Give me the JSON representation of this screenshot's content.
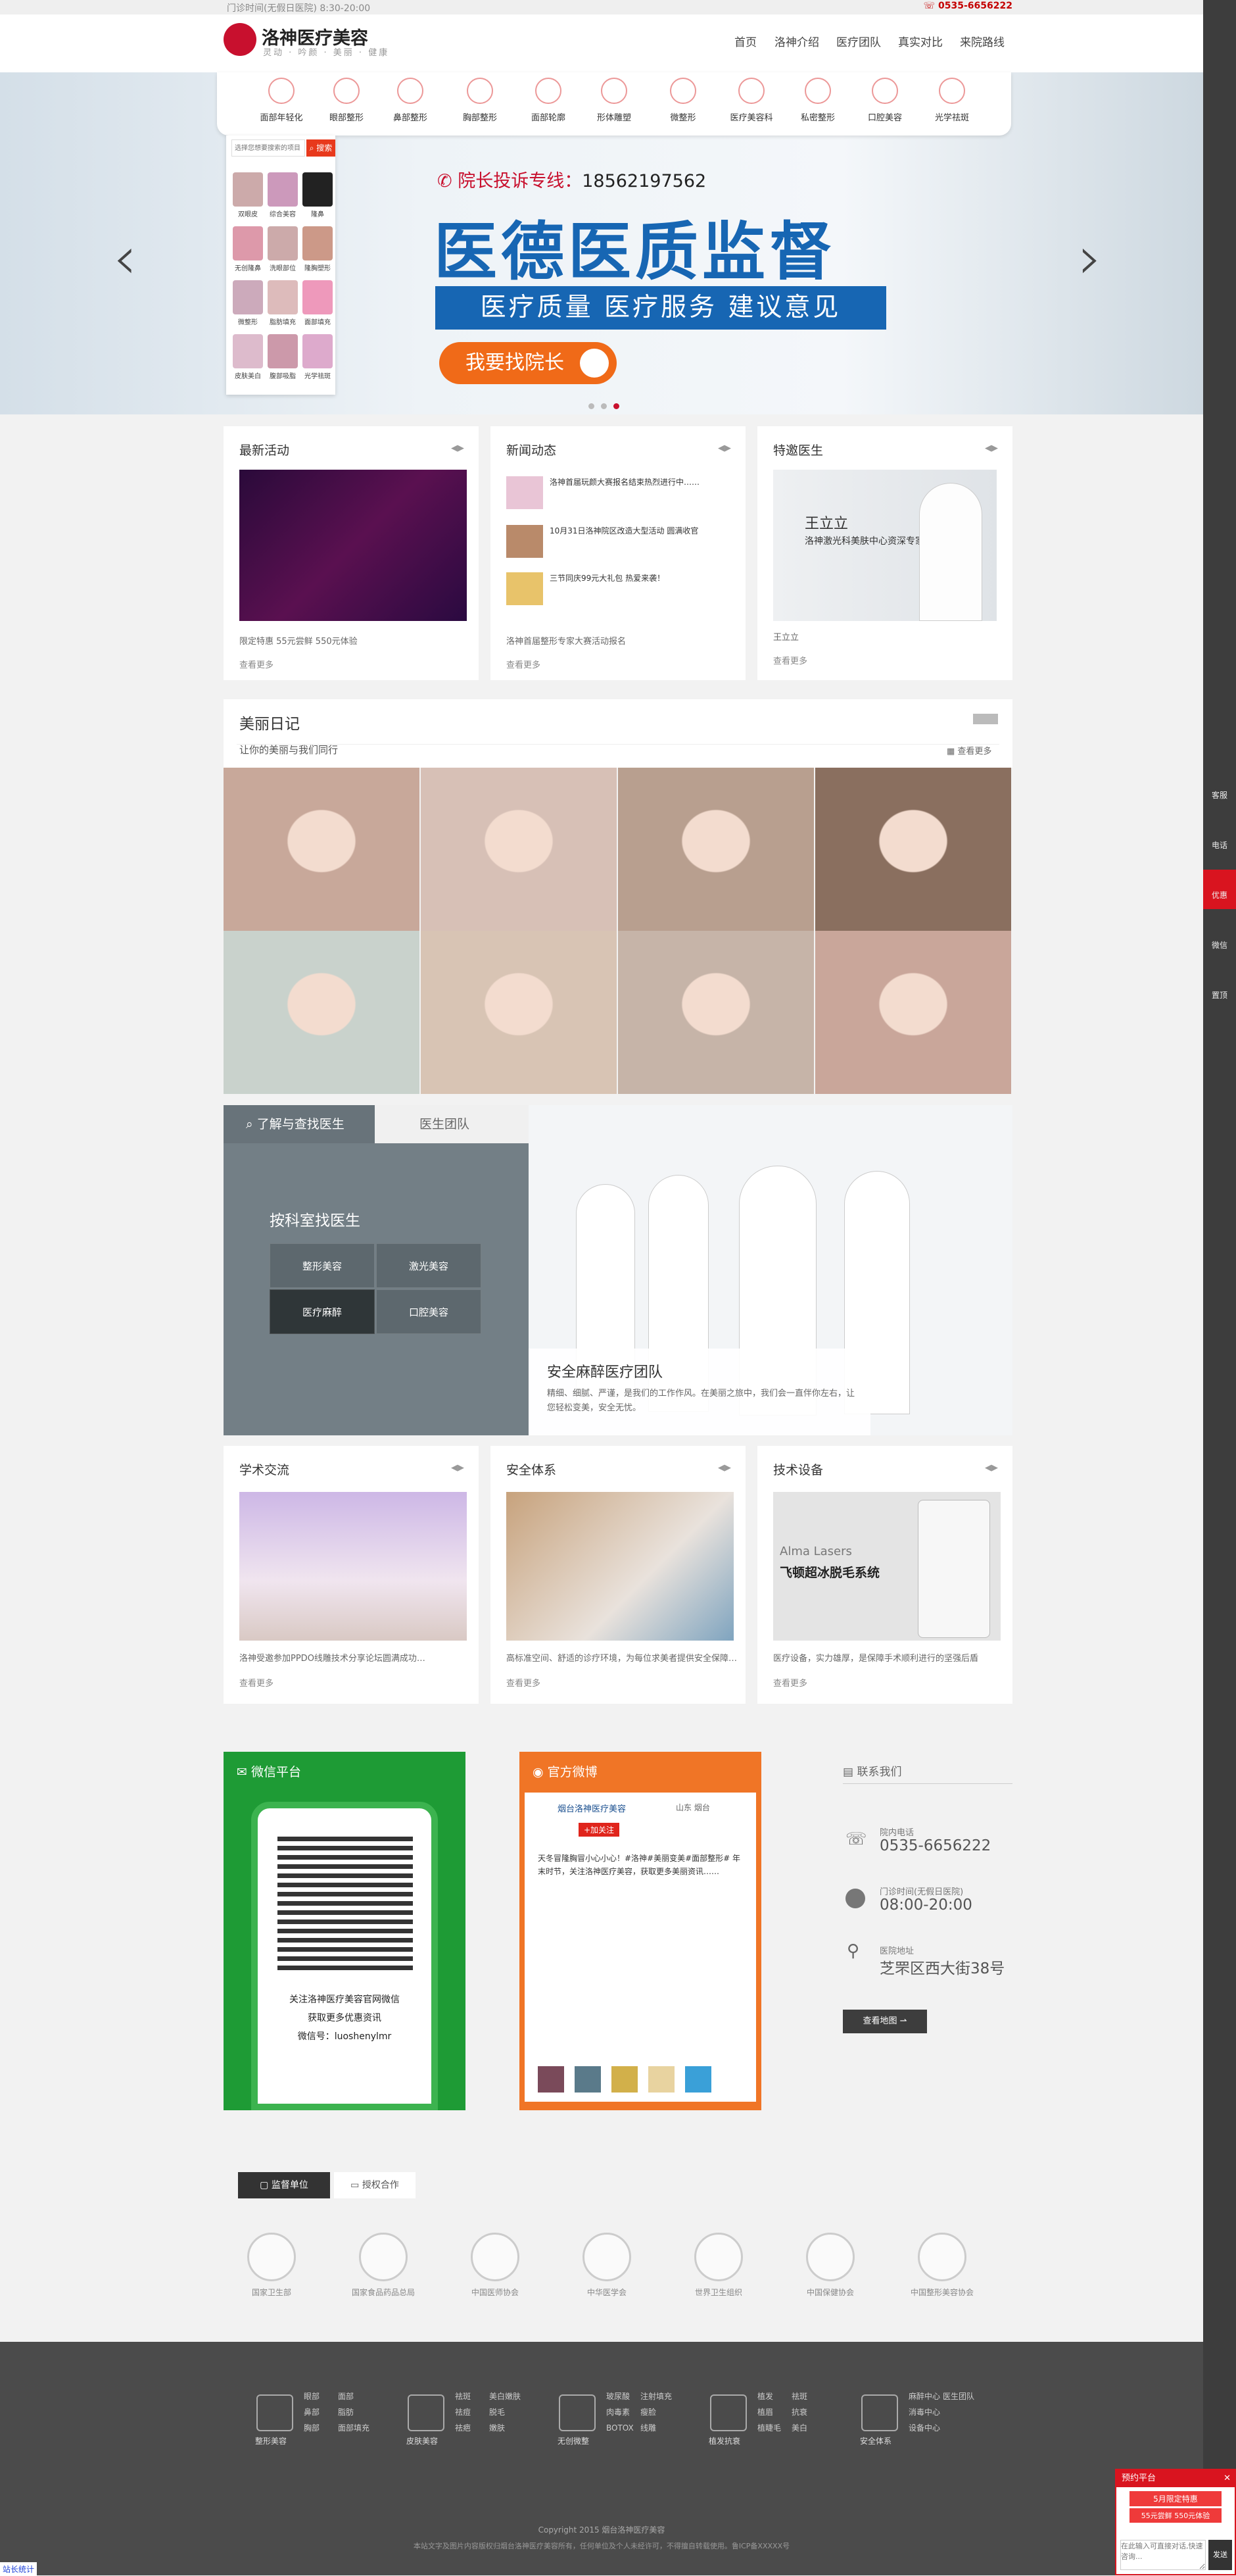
{
  "topstrip": {
    "hours": "门诊时间(无假日医院) 8:30-20:00",
    "phone": "0535-6656222"
  },
  "header": {
    "brand": "洛神医疗美容",
    "tagline": "灵动 · 吟颜 · 美丽 · 健康",
    "nav": [
      "首页",
      "洛神介绍",
      "医疗团队",
      "真实对比",
      "来院路线"
    ]
  },
  "categories": [
    "面部年轻化",
    "眼部整形",
    "鼻部整形",
    "胸部整形",
    "面部轮廓",
    "形体雕塑",
    "微整形",
    "医疗美容科",
    "私密整形",
    "口腔美容",
    "光学祛斑"
  ],
  "search": {
    "placeholder": "选择您想要搜索的项目",
    "button": "搜索"
  },
  "projects": [
    "双眼皮",
    "综合美容",
    "隆鼻",
    "无创隆鼻",
    "洗眼部位",
    "隆胸塑形",
    "微整形",
    "脂肪填充",
    "面部填充",
    "皮肤美白",
    "腹部吸脂",
    "光学祛斑"
  ],
  "hero": {
    "hotline_label": "院长投诉专线：",
    "hotline_number": "18562197562",
    "title": "医德医质监督",
    "subtitle": "医疗质量 医疗服务 建议意见",
    "button": "我要找院长"
  },
  "activities": {
    "title": "最新活动",
    "caption": "限定特惠 55元尝鲜 550元体验",
    "more": "查看更多"
  },
  "news": {
    "title": "新闻动态",
    "items": [
      "洛神首届玩颜大赛报名结束热烈进行中……",
      "10月31日洛神院区改造大型活动 圆满收官",
      "三节同庆99元大礼包 热爱来袭！"
    ],
    "caption": "洛神首届整形专家大赛活动报名",
    "more": "查看更多"
  },
  "doctor": {
    "title": "特邀医生",
    "name": "王立立",
    "role": "洛神激光科美肤中心资深专家",
    "caption": "王立立",
    "more": "查看更多"
  },
  "diary": {
    "title": "美丽日记",
    "subtitle": "让你的美丽与我们同行",
    "more": "查看更多"
  },
  "team": {
    "tab1": "了解与查找医生",
    "tab2": "医生团队",
    "find_title": "按科室找医生",
    "departments": [
      "整形美容",
      "激光美容",
      "医疗麻醉",
      "口腔美容"
    ],
    "panel_title": "安全麻醉医疗团队",
    "panel_text": "精细、细腻、严谨，是我们的工作作风。在美丽之旅中，我们会一直伴你左右，让您轻松变美，安全无忧。"
  },
  "cards2": [
    {
      "title": "学术交流",
      "caption": "洛神受邀参加PPDO线雕技术分享论坛圆满成功…",
      "more": "查看更多"
    },
    {
      "title": "安全体系",
      "caption": "高标准空间、舒适的诊疗环境，为每位求美者提供安全保障…",
      "more": "查看更多"
    },
    {
      "title": "技术设备",
      "caption": "医疗设备，实力雄厚，是保障手术顺利进行的坚强后盾",
      "more": "查看更多",
      "device_brand": "Alma Lasers",
      "device_name": "飞顿超冰脱毛系统"
    }
  ],
  "wechat": {
    "title": "微信平台",
    "line1": "关注洛神医疗美容官网微信",
    "line2": "获取更多优惠资讯",
    "line3": "微信号：luoshenylmr"
  },
  "weibo": {
    "title": "官方微博",
    "account": "烟台洛神医疗美容",
    "location": "山东 烟台",
    "follow": "+加关注",
    "post": "天冬冒隆胸冒小心小心！#洛神#美丽变美#面部整形# 年末时节，关注洛神医疗美容，获取更多美丽资讯……"
  },
  "contact": {
    "title": "联系我们",
    "phone_label": "院内电话",
    "phone": "0535-6656222",
    "hours_label": "门诊时间(无假日医院)",
    "hours": "08:00-20:00",
    "addr_label": "医院地址",
    "addr": "芝罘区西大街38号",
    "map_button": "查看地图"
  },
  "tabs": [
    "监督单位",
    "授权合作"
  ],
  "orgs": [
    "国家卫生部",
    "国家食品药品总局",
    "中国医师协会",
    "中华医学会",
    "世界卫生组织",
    "中国保健协会",
    "中国整形美容协会"
  ],
  "footer": {
    "cols": [
      {
        "head": "整形美容",
        "items": [
          "眼部",
          "鼻部",
          "胸部",
          "面部",
          "脂肪",
          "面部填充"
        ]
      },
      {
        "head": "皮肤美容",
        "items": [
          "祛斑",
          "祛痘",
          "祛疤",
          "美白嫩肤",
          "脱毛",
          "嫩肤"
        ]
      },
      {
        "head": "无创微整",
        "items": [
          "玻尿酸",
          "肉毒素",
          "BOTOX",
          "注射填充",
          "瘦脸",
          "线雕"
        ]
      },
      {
        "head": "植发抗衰",
        "items": [
          "植发",
          "植眉",
          "植睫毛",
          "祛斑",
          "抗衰",
          "美白"
        ]
      },
      {
        "head": "安全体系",
        "items": [
          "麻醉中心",
          "消毒中心",
          "设备中心",
          "医生团队"
        ]
      }
    ],
    "copyright": "Copyright 2015 烟台洛神医疗美容",
    "notice": "本站文字及图片内容版权归烟台洛神医疗美容所有，任何单位及个人未经许可，不得擅自转载使用。鲁ICP备XXXXX号"
  },
  "sidebar": [
    "客服",
    "电话",
    "优惠",
    "微信",
    "置顶"
  ],
  "popup": {
    "title": "预约平台",
    "line1": "5月限定特惠",
    "line2": "55元尝鲜 550元体验",
    "placeholder": "在此输入可直接对话,快速咨询...",
    "send": "发送"
  },
  "stat": "站长统计"
}
